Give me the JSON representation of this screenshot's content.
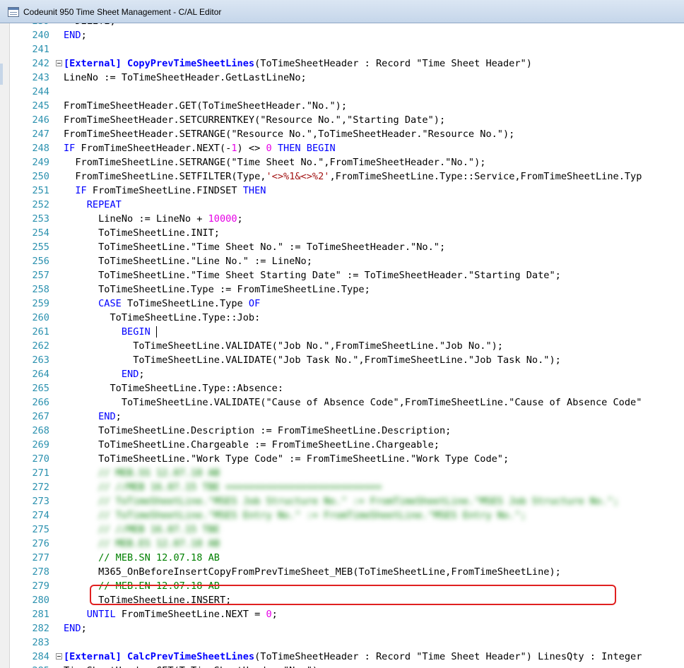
{
  "window": {
    "title": "Codeunit 950 Time Sheet Management - C/AL Editor"
  },
  "editor": {
    "lines": [
      {
        "n": "239",
        "fold": false,
        "indent": 0,
        "segs": [
          [
            "p",
            "  DELETE;"
          ]
        ]
      },
      {
        "n": "240",
        "fold": false,
        "indent": 0,
        "segs": [
          [
            "k",
            "END"
          ],
          [
            "p",
            ";"
          ]
        ]
      },
      {
        "n": "241",
        "fold": false,
        "indent": 0,
        "segs": []
      },
      {
        "n": "242",
        "fold": true,
        "indent": 0,
        "segs": [
          [
            "x",
            "[External] CopyPrevTimeSheetLines"
          ],
          [
            "p",
            "(ToTimeSheetHeader : Record \"Time Sheet Header\")"
          ]
        ]
      },
      {
        "n": "243",
        "fold": false,
        "indent": 0,
        "segs": [
          [
            "p",
            "LineNo := ToTimeSheetHeader.GetLastLineNo;"
          ]
        ]
      },
      {
        "n": "244",
        "fold": false,
        "indent": 0,
        "segs": []
      },
      {
        "n": "245",
        "fold": false,
        "indent": 0,
        "segs": [
          [
            "p",
            "FromTimeSheetHeader.GET(ToTimeSheetHeader.\"No.\");"
          ]
        ]
      },
      {
        "n": "246",
        "fold": false,
        "indent": 0,
        "segs": [
          [
            "p",
            "FromTimeSheetHeader.SETCURRENTKEY(\"Resource No.\",\"Starting Date\");"
          ]
        ]
      },
      {
        "n": "247",
        "fold": false,
        "indent": 0,
        "segs": [
          [
            "p",
            "FromTimeSheetHeader.SETRANGE(\"Resource No.\",ToTimeSheetHeader.\"Resource No.\");"
          ]
        ]
      },
      {
        "n": "248",
        "fold": false,
        "indent": 0,
        "segs": [
          [
            "k",
            "IF"
          ],
          [
            "p",
            " FromTimeSheetHeader.NEXT(-"
          ],
          [
            "n",
            "1"
          ],
          [
            "p",
            ") <> "
          ],
          [
            "n",
            "0"
          ],
          [
            "p",
            " "
          ],
          [
            "k",
            "THEN BEGIN"
          ]
        ]
      },
      {
        "n": "249",
        "fold": false,
        "indent": 0,
        "segs": [
          [
            "p",
            "  FromTimeSheetLine.SETRANGE(\"Time Sheet No.\",FromTimeSheetHeader.\"No.\");"
          ]
        ]
      },
      {
        "n": "250",
        "fold": false,
        "indent": 0,
        "segs": [
          [
            "p",
            "  FromTimeSheetLine.SETFILTER(Type,"
          ],
          [
            "s",
            "'<>%1&<>%2'"
          ],
          [
            "p",
            ",FromTimeSheetLine.Type::Service,FromTimeSheetLine.Typ"
          ]
        ]
      },
      {
        "n": "251",
        "fold": false,
        "indent": 0,
        "segs": [
          [
            "p",
            "  "
          ],
          [
            "k",
            "IF"
          ],
          [
            "p",
            " FromTimeSheetLine.FINDSET "
          ],
          [
            "k",
            "THEN"
          ]
        ]
      },
      {
        "n": "252",
        "fold": false,
        "indent": 0,
        "segs": [
          [
            "p",
            "    "
          ],
          [
            "k",
            "REPEAT"
          ]
        ]
      },
      {
        "n": "253",
        "fold": false,
        "indent": 0,
        "segs": [
          [
            "p",
            "      LineNo := LineNo + "
          ],
          [
            "n",
            "10000"
          ],
          [
            "p",
            ";"
          ]
        ]
      },
      {
        "n": "254",
        "fold": false,
        "indent": 0,
        "segs": [
          [
            "p",
            "      ToTimeSheetLine.INIT;"
          ]
        ]
      },
      {
        "n": "255",
        "fold": false,
        "indent": 0,
        "segs": [
          [
            "p",
            "      ToTimeSheetLine.\"Time Sheet No.\" := ToTimeSheetHeader.\"No.\";"
          ]
        ]
      },
      {
        "n": "256",
        "fold": false,
        "indent": 0,
        "segs": [
          [
            "p",
            "      ToTimeSheetLine.\"Line No.\" := LineNo;"
          ]
        ]
      },
      {
        "n": "257",
        "fold": false,
        "indent": 0,
        "segs": [
          [
            "p",
            "      ToTimeSheetLine.\"Time Sheet Starting Date\" := ToTimeSheetHeader.\"Starting Date\";"
          ]
        ]
      },
      {
        "n": "258",
        "fold": false,
        "indent": 0,
        "segs": [
          [
            "p",
            "      ToTimeSheetLine.Type := FromTimeSheetLine.Type;"
          ]
        ]
      },
      {
        "n": "259",
        "fold": false,
        "indent": 0,
        "segs": [
          [
            "p",
            "      "
          ],
          [
            "k",
            "CASE"
          ],
          [
            "p",
            " ToTimeSheetLine.Type "
          ],
          [
            "k",
            "OF"
          ]
        ]
      },
      {
        "n": "260",
        "fold": false,
        "indent": 0,
        "segs": [
          [
            "p",
            "        ToTimeSheetLine.Type::Job:"
          ]
        ]
      },
      {
        "n": "261",
        "fold": false,
        "indent": 0,
        "segs": [
          [
            "p",
            "          "
          ],
          [
            "k",
            "BEGIN"
          ],
          [
            "c",
            ""
          ]
        ]
      },
      {
        "n": "262",
        "fold": false,
        "indent": 0,
        "segs": [
          [
            "p",
            "            ToTimeSheetLine.VALIDATE(\"Job No.\",FromTimeSheetLine.\"Job No.\");"
          ]
        ]
      },
      {
        "n": "263",
        "fold": false,
        "indent": 0,
        "segs": [
          [
            "p",
            "            ToTimeSheetLine.VALIDATE(\"Job Task No.\",FromTimeSheetLine.\"Job Task No.\");"
          ]
        ]
      },
      {
        "n": "264",
        "fold": false,
        "indent": 0,
        "segs": [
          [
            "p",
            "          "
          ],
          [
            "k",
            "END"
          ],
          [
            "p",
            ";"
          ]
        ]
      },
      {
        "n": "265",
        "fold": false,
        "indent": 0,
        "segs": [
          [
            "p",
            "        ToTimeSheetLine.Type::Absence:"
          ]
        ]
      },
      {
        "n": "266",
        "fold": false,
        "indent": 0,
        "segs": [
          [
            "p",
            "          ToTimeSheetLine.VALIDATE(\"Cause of Absence Code\",FromTimeSheetLine.\"Cause of Absence Code\""
          ]
        ]
      },
      {
        "n": "267",
        "fold": false,
        "indent": 0,
        "segs": [
          [
            "p",
            "      "
          ],
          [
            "k",
            "END"
          ],
          [
            "p",
            ";"
          ]
        ]
      },
      {
        "n": "268",
        "fold": false,
        "indent": 0,
        "segs": [
          [
            "p",
            "      ToTimeSheetLine.Description := FromTimeSheetLine.Description;"
          ]
        ]
      },
      {
        "n": "269",
        "fold": false,
        "indent": 0,
        "segs": [
          [
            "p",
            "      ToTimeSheetLine.Chargeable := FromTimeSheetLine.Chargeable;"
          ]
        ]
      },
      {
        "n": "270",
        "fold": false,
        "indent": 0,
        "segs": [
          [
            "p",
            "      ToTimeSheetLine.\"Work Type Code\" := FromTimeSheetLine.\"Work Type Code\";"
          ]
        ]
      },
      {
        "n": "271",
        "fold": false,
        "indent": 0,
        "segs": [
          [
            "b",
            "      // MEB.SS 12.07.18 AB"
          ]
        ]
      },
      {
        "n": "272",
        "fold": false,
        "indent": 0,
        "segs": [
          [
            "b",
            "      // //MEB 16.07.15 TBE ==========================="
          ]
        ]
      },
      {
        "n": "273",
        "fold": false,
        "indent": 0,
        "segs": [
          [
            "b",
            "      // ToTimeSheetLine.\"MSES Job Structure No.\" := FromTimeSheetLine.\"MSES Job Structure No.\";"
          ]
        ]
      },
      {
        "n": "274",
        "fold": false,
        "indent": 0,
        "segs": [
          [
            "b",
            "      // ToTimeSheetLine.\"MSES Entry No.\" := FromTimeSheetLine.\"MSES Entry No.\";"
          ]
        ]
      },
      {
        "n": "275",
        "fold": false,
        "indent": 0,
        "segs": [
          [
            "b",
            "      // //MEB 16.07.15 TBE"
          ]
        ]
      },
      {
        "n": "276",
        "fold": false,
        "indent": 0,
        "segs": [
          [
            "b",
            "      // MEB.ES 12.07.18 AB"
          ]
        ]
      },
      {
        "n": "277",
        "fold": false,
        "indent": 0,
        "segs": [
          [
            "c",
            "      // MEB.SN 12.07.18 AB"
          ]
        ]
      },
      {
        "n": "278",
        "fold": false,
        "indent": 0,
        "segs": [
          [
            "p",
            "      M365_OnBeforeInsertCopyFromPrevTimeSheet_MEB(ToTimeSheetLine,FromTimeSheetLine);"
          ]
        ]
      },
      {
        "n": "279",
        "fold": false,
        "indent": 0,
        "segs": [
          [
            "c",
            "      // MEB.EN 12.07.18 AB"
          ]
        ]
      },
      {
        "n": "280",
        "fold": false,
        "indent": 0,
        "segs": [
          [
            "p",
            "      ToTimeSheetLine.INSERT;"
          ]
        ]
      },
      {
        "n": "281",
        "fold": false,
        "indent": 0,
        "segs": [
          [
            "p",
            "    "
          ],
          [
            "k",
            "UNTIL"
          ],
          [
            "p",
            " FromTimeSheetLine.NEXT = "
          ],
          [
            "n",
            "0"
          ],
          [
            "p",
            ";"
          ]
        ]
      },
      {
        "n": "282",
        "fold": false,
        "indent": 0,
        "segs": [
          [
            "k",
            "END"
          ],
          [
            "p",
            ";"
          ]
        ]
      },
      {
        "n": "283",
        "fold": false,
        "indent": 0,
        "segs": []
      },
      {
        "n": "284",
        "fold": true,
        "indent": 0,
        "segs": [
          [
            "x",
            "[External] CalcPrevTimeSheetLines"
          ],
          [
            "p",
            "(ToTimeSheetHeader : Record \"Time Sheet Header\") LinesQty : Integer"
          ]
        ]
      },
      {
        "n": "285",
        "fold": false,
        "indent": 0,
        "segs": [
          [
            "p",
            "TimeSheetHeader.GET(ToTimeSheetHeader.\"No.\");"
          ]
        ]
      }
    ]
  }
}
